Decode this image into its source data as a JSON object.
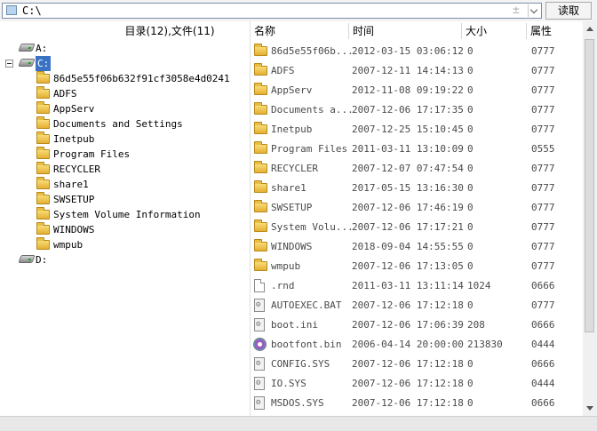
{
  "address_bar": {
    "path": "C:\\",
    "plus_glyph": "±",
    "read_button": "读取"
  },
  "left_panel": {
    "summary": "目录(12),文件(11)"
  },
  "tree": [
    {
      "label": "A:",
      "type": "drive",
      "level": 0
    },
    {
      "label": "C:",
      "type": "drive",
      "level": 0,
      "expanded": true,
      "selected": true
    },
    {
      "label": "86d5e55f06b632f91cf3058e4d0241",
      "type": "folder",
      "level": 1
    },
    {
      "label": "ADFS",
      "type": "folder",
      "level": 1
    },
    {
      "label": "AppServ",
      "type": "folder",
      "level": 1
    },
    {
      "label": "Documents and Settings",
      "type": "folder",
      "level": 1
    },
    {
      "label": "Inetpub",
      "type": "folder",
      "level": 1
    },
    {
      "label": "Program Files",
      "type": "folder",
      "level": 1
    },
    {
      "label": "RECYCLER",
      "type": "folder",
      "level": 1
    },
    {
      "label": "share1",
      "type": "folder",
      "level": 1
    },
    {
      "label": "SWSETUP",
      "type": "folder",
      "level": 1
    },
    {
      "label": "System Volume Information",
      "type": "folder",
      "level": 1
    },
    {
      "label": "WINDOWS",
      "type": "folder",
      "level": 1
    },
    {
      "label": "wmpub",
      "type": "folder",
      "level": 1
    },
    {
      "label": "D:",
      "type": "drive",
      "level": 0
    }
  ],
  "columns": {
    "name": "名称",
    "time": "时间",
    "size": "大小",
    "attr": "属性"
  },
  "files": [
    {
      "name": "86d5e55f06b...",
      "time": "2012-03-15 03:06:12",
      "size": "0",
      "attr": "0777",
      "icon": "folder-icon"
    },
    {
      "name": "ADFS",
      "time": "2007-12-11 14:14:13",
      "size": "0",
      "attr": "0777",
      "icon": "folder-icon"
    },
    {
      "name": "AppServ",
      "time": "2012-11-08 09:19:22",
      "size": "0",
      "attr": "0777",
      "icon": "folder-icon"
    },
    {
      "name": "Documents a...",
      "time": "2007-12-06 17:17:35",
      "size": "0",
      "attr": "0777",
      "icon": "folder-icon"
    },
    {
      "name": "Inetpub",
      "time": "2007-12-25 15:10:45",
      "size": "0",
      "attr": "0777",
      "icon": "folder-icon"
    },
    {
      "name": "Program Files",
      "time": "2011-03-11 13:10:09",
      "size": "0",
      "attr": "0555",
      "icon": "folder-icon"
    },
    {
      "name": "RECYCLER",
      "time": "2007-12-07 07:47:54",
      "size": "0",
      "attr": "0777",
      "icon": "folder-icon"
    },
    {
      "name": "share1",
      "time": "2017-05-15 13:16:30",
      "size": "0",
      "attr": "0777",
      "icon": "folder-icon"
    },
    {
      "name": "SWSETUP",
      "time": "2007-12-06 17:46:19",
      "size": "0",
      "attr": "0777",
      "icon": "folder-icon"
    },
    {
      "name": "System Volu...",
      "time": "2007-12-06 17:17:21",
      "size": "0",
      "attr": "0777",
      "icon": "folder-icon"
    },
    {
      "name": "WINDOWS",
      "time": "2018-09-04 14:55:55",
      "size": "0",
      "attr": "0777",
      "icon": "folder-icon"
    },
    {
      "name": "wmpub",
      "time": "2007-12-06 17:13:05",
      "size": "0",
      "attr": "0777",
      "icon": "folder-icon"
    },
    {
      "name": ".rnd",
      "time": "2011-03-11 13:11:14",
      "size": "1024",
      "attr": "0666",
      "icon": "file-icon"
    },
    {
      "name": "AUTOEXEC.BAT",
      "time": "2007-12-06 17:12:18",
      "size": "0",
      "attr": "0777",
      "icon": "system-file-icon"
    },
    {
      "name": "boot.ini",
      "time": "2007-12-06 17:06:39",
      "size": "208",
      "attr": "0666",
      "icon": "system-file-icon"
    },
    {
      "name": "bootfont.bin",
      "time": "2006-04-14 20:00:00",
      "size": "213830",
      "attr": "0444",
      "icon": "disc-file-icon"
    },
    {
      "name": "CONFIG.SYS",
      "time": "2007-12-06 17:12:18",
      "size": "0",
      "attr": "0666",
      "icon": "system-file-icon"
    },
    {
      "name": "IO.SYS",
      "time": "2007-12-06 17:12:18",
      "size": "0",
      "attr": "0444",
      "icon": "system-file-icon"
    },
    {
      "name": "MSDOS.SYS",
      "time": "2007-12-06 17:12:18",
      "size": "0",
      "attr": "0666",
      "icon": "system-file-icon"
    }
  ],
  "colors": {
    "selection": "#3a73c6",
    "folder": "#f0c850"
  }
}
